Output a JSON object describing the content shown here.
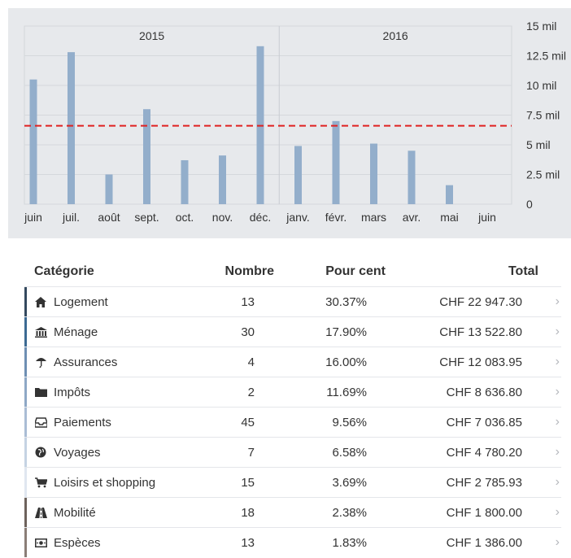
{
  "chart_data": {
    "type": "bar",
    "categories": [
      "juin",
      "juil.",
      "août",
      "sept.",
      "oct.",
      "nov.",
      "déc.",
      "janv.",
      "févr.",
      "mars",
      "avr.",
      "mai",
      "juin"
    ],
    "values": [
      10500,
      12800,
      2500,
      8000,
      3700,
      4100,
      13300,
      4900,
      7000,
      5100,
      4500,
      1600,
      0
    ],
    "year_groups": [
      {
        "label": "2015",
        "categories": [
          "juin",
          "juil.",
          "août",
          "sept.",
          "oct.",
          "nov.",
          "déc."
        ]
      },
      {
        "label": "2016",
        "categories": [
          "janv.",
          "févr.",
          "mars",
          "avr.",
          "mai",
          "juin"
        ]
      }
    ],
    "y_ticks": [
      {
        "value": 0,
        "label": "0"
      },
      {
        "value": 2500,
        "label": "2.5 mil"
      },
      {
        "value": 5000,
        "label": "5 mil"
      },
      {
        "value": 7500,
        "label": "7.5 mil"
      },
      {
        "value": 10000,
        "label": "10 mil"
      },
      {
        "value": 12500,
        "label": "12.5 mil"
      },
      {
        "value": 15000,
        "label": "15 mil"
      }
    ],
    "ylim": [
      0,
      15000
    ],
    "reference_line": 6600,
    "bar_color": "#93aecb",
    "reference_color": "#e02020"
  },
  "table": {
    "headers": {
      "category": "Catégorie",
      "count": "Nombre",
      "percent": "Pour cent",
      "total": "Total"
    },
    "rows": [
      {
        "icon": "home-icon",
        "category": "Logement",
        "count": "13",
        "percent": "30.37%",
        "total": "CHF 22 947.30",
        "color": "#34495e"
      },
      {
        "icon": "bank-icon",
        "category": "Ménage",
        "count": "30",
        "percent": "17.90%",
        "total": "CHF 13 522.80",
        "color": "#3c6a93"
      },
      {
        "icon": "umbrella-icon",
        "category": "Assurances",
        "count": "4",
        "percent": "16.00%",
        "total": "CHF 12 083.95",
        "color": "#6e8fb3"
      },
      {
        "icon": "folder-icon",
        "category": "Impôts",
        "count": "2",
        "percent": "11.69%",
        "total": "CHF 8 636.80",
        "color": "#8ea8c6"
      },
      {
        "icon": "inbox-icon",
        "category": "Paiements",
        "count": "45",
        "percent": "9.56%",
        "total": "CHF 7 036.85",
        "color": "#aabdd5"
      },
      {
        "icon": "globe-icon",
        "category": "Voyages",
        "count": "7",
        "percent": "6.58%",
        "total": "CHF 4 780.20",
        "color": "#c5d3e3"
      },
      {
        "icon": "cart-icon",
        "category": "Loisirs et shopping",
        "count": "15",
        "percent": "3.69%",
        "total": "CHF 2 785.93",
        "color": "#e0e7f0"
      },
      {
        "icon": "road-icon",
        "category": "Mobilité",
        "count": "18",
        "percent": "2.38%",
        "total": "CHF 1 800.00",
        "color": "#6d625c"
      },
      {
        "icon": "money-icon",
        "category": "Espèces",
        "count": "13",
        "percent": "1.83%",
        "total": "CHF 1 386.00",
        "color": "#8a7d77"
      }
    ]
  }
}
